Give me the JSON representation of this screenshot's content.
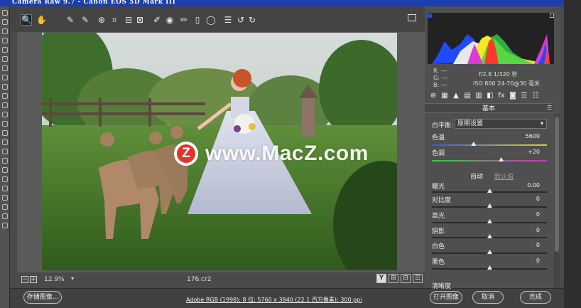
{
  "window": {
    "title": "Camera Raw 9.7 - Canon EOS 5D Mark III"
  },
  "toolbar": {
    "tools": [
      {
        "name": "zoom-tool-icon",
        "glyph": "🔍"
      },
      {
        "name": "hand-tool-icon",
        "glyph": "✋"
      },
      {
        "name": "white-balance-tool-icon",
        "glyph": "✎"
      },
      {
        "name": "color-sampler-tool-icon",
        "glyph": "✎"
      },
      {
        "name": "targeted-adjustment-tool-icon",
        "glyph": "⊕"
      },
      {
        "name": "crop-tool-icon",
        "glyph": "⌗"
      },
      {
        "name": "straighten-tool-icon",
        "glyph": "⊟"
      },
      {
        "name": "transform-tool-icon",
        "glyph": "⊠"
      },
      {
        "name": "spot-removal-tool-icon",
        "glyph": "✐"
      },
      {
        "name": "red-eye-tool-icon",
        "glyph": "◉"
      },
      {
        "name": "adjustment-brush-icon",
        "glyph": "✏"
      },
      {
        "name": "graduated-filter-icon",
        "glyph": "▯"
      },
      {
        "name": "radial-filter-icon",
        "glyph": "◯"
      },
      {
        "name": "preferences-icon",
        "glyph": "☰"
      },
      {
        "name": "rotate-left-icon",
        "glyph": "↺"
      },
      {
        "name": "rotate-right-icon",
        "glyph": "↻"
      }
    ]
  },
  "watermark": {
    "logo_letter": "Z",
    "text": "www.MacZ.com"
  },
  "canvas_status": {
    "zoom_out": "−",
    "zoom_in": "+",
    "zoom": "12.9%",
    "zoom_arrow": "▾",
    "filename": "176.cr2",
    "view_buttons": [
      "Y",
      "⊞",
      "⊟",
      "☰"
    ]
  },
  "histogram": {
    "r": "R:  ---",
    "g": "G:  ---",
    "b": "B:  ---",
    "aperture_shutter": "f/2.8   1/320 秒",
    "iso_lens": "ISO 800   24-70@30 毫米"
  },
  "panel": {
    "tabs": [
      "⊛",
      "▦",
      "▲",
      "▤",
      "▥",
      "◧",
      "fx",
      "◙",
      "☰",
      "☷"
    ],
    "title": "基本",
    "menu": "☰",
    "white_balance_label": "白平衡:",
    "white_balance_value": "原照设置",
    "auto_label": "自动",
    "default_label": "默认值",
    "sliders": [
      {
        "name": "temperature",
        "label": "色温",
        "value": "5600",
        "fraction": 0.36,
        "gradient": "linear-gradient(90deg,#3b5bd6,#d9cf3a)"
      },
      {
        "name": "tint",
        "label": "色调",
        "value": "+20",
        "fraction": 0.6,
        "gradient": "linear-gradient(90deg,#3ac94a,#c93ab5)"
      },
      {
        "name": "exposure",
        "label": "曝光",
        "value": "0.00",
        "fraction": 0.5,
        "gradient": ""
      },
      {
        "name": "contrast",
        "label": "对比度",
        "value": "0",
        "fraction": 0.5,
        "gradient": ""
      },
      {
        "name": "highlights",
        "label": "高光",
        "value": "0",
        "fraction": 0.5,
        "gradient": ""
      },
      {
        "name": "shadows",
        "label": "阴影",
        "value": "0",
        "fraction": 0.5,
        "gradient": ""
      },
      {
        "name": "whites",
        "label": "白色",
        "value": "0",
        "fraction": 0.5,
        "gradient": ""
      },
      {
        "name": "blacks",
        "label": "黑色",
        "value": "0",
        "fraction": 0.5,
        "gradient": ""
      },
      {
        "name": "clarity",
        "label": "清晰度",
        "value": "",
        "fraction": 0.5,
        "gradient": ""
      }
    ]
  },
  "bottom": {
    "save_label": "存储图像...",
    "workflow": "Adobe RGB (1998); 8 位; 5760 x 3840 (22.1 百万像素); 300 ppi",
    "open_label": "打开图像",
    "cancel_label": "取消",
    "done_label": "完成"
  },
  "colors": {
    "title_bar": "#1b3fae",
    "watermark_red": "#e4352c"
  }
}
